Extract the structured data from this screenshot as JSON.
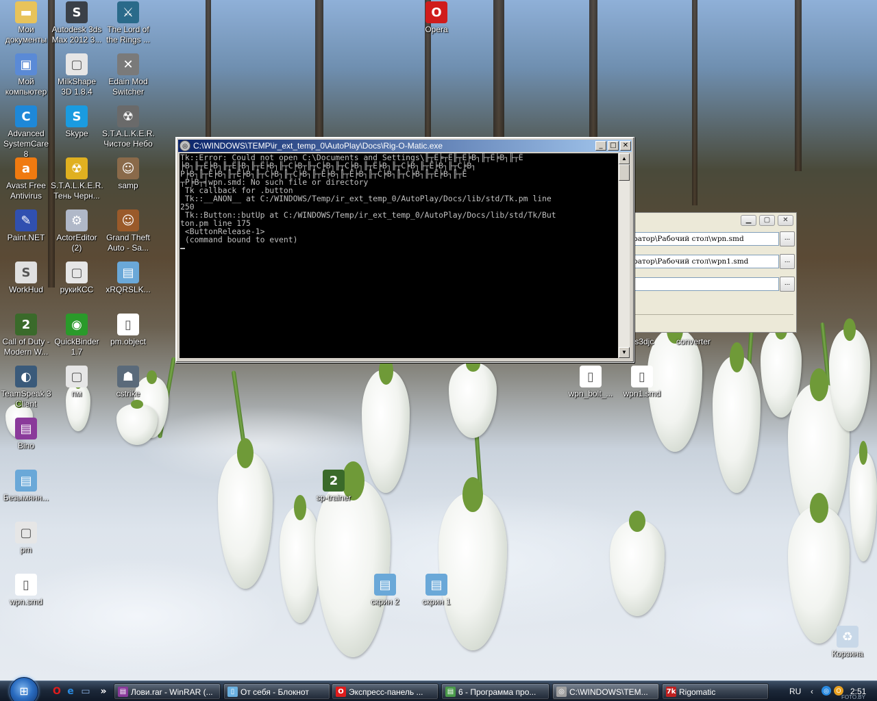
{
  "desktop_icons": [
    {
      "label": "Мои\nдокументы",
      "icon": "folder-icon",
      "color": "#e8c35a",
      "glyph": "▬"
    },
    {
      "label": "Autodesk 3ds\nMax 2012 3...",
      "icon": "3dsmax-icon",
      "color": "#3a4048",
      "glyph": "S"
    },
    {
      "label": "The Lord of\nthe Rings ...",
      "icon": "lotr-game-icon",
      "color": "#2a6a8a",
      "glyph": "⚔"
    },
    {
      "label": "Opera",
      "icon": "opera-icon",
      "color": "#d01c1c",
      "glyph": "O"
    },
    {
      "label": "Мой\nкомпьютер",
      "icon": "computer-icon",
      "color": "#5a8ad6",
      "glyph": "▣"
    },
    {
      "label": "MilkShape\n3D 1.8.4",
      "icon": "milkshape-icon",
      "color": "#e6e6e6",
      "glyph": "▢"
    },
    {
      "label": "Edain Mod\nSwitcher",
      "icon": "sword-icon",
      "color": "#7a7a7a",
      "glyph": "✕"
    },
    {
      "label": "Advanced\nSystemCare 8",
      "icon": "systemcare-icon",
      "color": "#1e88d8",
      "glyph": "C"
    },
    {
      "label": "Skype",
      "icon": "skype-icon",
      "color": "#1a9be0",
      "glyph": "S"
    },
    {
      "label": "S.T.A.L.K.E.R.\nЧистое Небо",
      "icon": "stalker-icon",
      "color": "#6a6a6a",
      "glyph": "☢"
    },
    {
      "label": "Avast Free\nAntivirus",
      "icon": "avast-icon",
      "color": "#f07a10",
      "glyph": "a"
    },
    {
      "label": "S.T.A.L.K.E.R.\nТень Черн...",
      "icon": "radiation-icon",
      "color": "#e0b020",
      "glyph": "☢"
    },
    {
      "label": "samp",
      "icon": "samp-icon",
      "color": "#8a6a4a",
      "glyph": "☺"
    },
    {
      "label": "Paint.NET",
      "icon": "paintnet-icon",
      "color": "#3050b0",
      "glyph": "✎"
    },
    {
      "label": "ActorEditor\n(2)",
      "icon": "gear-icon",
      "color": "#b0b8c8",
      "glyph": "⚙"
    },
    {
      "label": "Grand Theft\nAuto - Sa...",
      "icon": "gta-icon",
      "color": "#9a5a2a",
      "glyph": "☺"
    },
    {
      "label": "WorkHud",
      "icon": "3dsmax-file-icon",
      "color": "#e0e0e0",
      "glyph": "S"
    },
    {
      "label": "рукиКСС",
      "icon": "milkshape-file-icon",
      "color": "#e6e6e6",
      "glyph": "▢"
    },
    {
      "label": "xRQRSLK...",
      "icon": "image-file-icon",
      "color": "#6aa8d8",
      "glyph": "▤"
    },
    {
      "label": "Call of Duty -\nModern W...",
      "icon": "cod-icon",
      "color": "#3a6a2a",
      "glyph": "2"
    },
    {
      "label": "QuickBinder\n1.7",
      "icon": "quickbinder-icon",
      "color": "#2a9a2a",
      "glyph": "◉"
    },
    {
      "label": "pm.object",
      "icon": "document-icon",
      "color": "#ffffff",
      "glyph": "▯"
    },
    {
      "label": "TeamSpeak 3\nClient",
      "icon": "teamspeak-icon",
      "color": "#3a5a7a",
      "glyph": "◐"
    },
    {
      "label": "пм",
      "icon": "milkshape-file-icon",
      "color": "#e6e6e6",
      "glyph": "▢"
    },
    {
      "label": "cstrike",
      "icon": "counter-strike-icon",
      "color": "#5a6a7a",
      "glyph": "☗"
    },
    {
      "label": "Bino",
      "icon": "winrar-icon",
      "color": "#8a3a9a",
      "glyph": "▤"
    },
    {
      "label": "Безымянн...",
      "icon": "image-file-icon",
      "color": "#6aa8d8",
      "glyph": "▤"
    },
    {
      "label": "pm",
      "icon": "milkshape-file-icon",
      "color": "#e6e6e6",
      "glyph": "▢"
    },
    {
      "label": "wpn.smd",
      "icon": "document-icon",
      "color": "#ffffff",
      "glyph": "▯"
    },
    {
      "label": "sp-trainer",
      "icon": "cod-icon",
      "color": "#3a6a2a",
      "glyph": "2"
    },
    {
      "label": "скрин 2",
      "icon": "image-file-icon",
      "color": "#6aa8d8",
      "glyph": "▤"
    },
    {
      "label": "скрин 1",
      "icon": "image-file-icon",
      "color": "#6aa8d8",
      "glyph": "▤"
    },
    {
      "label": "ns3djc",
      "icon": "partial-icon",
      "color": "transparent",
      "glyph": ""
    },
    {
      "label": "converter",
      "icon": "partial-icon",
      "color": "transparent",
      "glyph": ""
    },
    {
      "label": "wpn_bolt_...",
      "icon": "document-icon",
      "color": "#ffffff",
      "glyph": "▯"
    },
    {
      "label": "wpn1.smd",
      "icon": "document-icon",
      "color": "#ffffff",
      "glyph": "▯"
    },
    {
      "label": "Корзина",
      "icon": "recycle-bin-icon",
      "color": "#c8d8e8",
      "glyph": "♻"
    }
  ],
  "console": {
    "title": "C:\\WINDOWS\\TEMP\\ir_ext_temp_0\\AutoPlay\\Docs\\Rig-O-Matic.exe",
    "icon": "console-app-icon",
    "lines": [
      "Tk::Error: Could not open C:\\Documents and Settings\\╟┬Ё╞┬Ё╟┬Ё╞В┐╟┬Ё╞В┐╟┬Ё",
      "╞В┐╟┬Ё╞В┐╟┬Ё╟В┐╟┬Ё╞В┐╟┬С╞В┬╟┬С╞В┐╟┬С╞В┐╟┬Ё╞В┐╟┬С╞В┐╟┬Ё╞В┐╟┬С╞В┐",
      "Р╞В┐╟┬Ё╞В┐╟┬Ё╞В┐╟┬С╞В┐╟┬С╞В┐╟┬Ё╞В┐╟┬Ё╞В┐╟┬С╞В┐╟┬С╞В┐╟┬Ё╞В┐╟┬Ё",
      "┬Р╞В┬╡wpn.smd: No such file or directory",
      " Tk callback for .button",
      " Tk::__ANON__ at C:/WINDOWS/Temp/ir_ext_temp_0/AutoPlay/Docs/lib/std/Tk.pm line",
      "250",
      " Tk::Button::butUp at C:/WINDOWS/Temp/ir_ext_temp_0/AutoPlay/Docs/lib/std/Tk/But",
      "ton.pm line 175",
      " <ButtonRelease-1>",
      " (command bound to event)"
    ],
    "text_color": "#c0c0c0",
    "background": "#000000"
  },
  "rigo_window": {
    "field1": "ратор\\Рабочий стол\\wpn.smd",
    "field2": "ратор\\Рабочий стол\\wpn1.smd",
    "field3": "",
    "browse_label": "..."
  },
  "taskbar": {
    "start_icon": "windows-logo-icon",
    "quick_launch": [
      {
        "icon": "opera-icon",
        "glyph": "O",
        "color": "#e01c1c"
      },
      {
        "icon": "internet-explorer-icon",
        "glyph": "e",
        "color": "#2a8ae0"
      },
      {
        "icon": "show-desktop-icon",
        "glyph": "▭",
        "color": "#8ab0e0"
      },
      {
        "icon": "chevron-right-icon",
        "glyph": "»",
        "color": "#ffffff"
      }
    ],
    "buttons": [
      {
        "label": "Лови.rar - WinRAR (...",
        "icon": "winrar-icon",
        "glyph": "▤",
        "color": "#8a3a9a"
      },
      {
        "label": "От себя - Блокнот",
        "icon": "notepad-icon",
        "glyph": "▯",
        "color": "#6ab0e0"
      },
      {
        "label": "Экспресс-панель ...",
        "icon": "opera-icon",
        "glyph": "O",
        "color": "#e01c1c"
      },
      {
        "label": "6 - Программа про...",
        "icon": "image-viewer-icon",
        "glyph": "▤",
        "color": "#4a9a4a"
      },
      {
        "label": "C:\\WINDOWS\\TEM...",
        "icon": "console-app-icon",
        "glyph": "◎",
        "color": "#a0a0a0"
      },
      {
        "label": "Rigomatic",
        "icon": "rigomatic-icon",
        "glyph": "7k",
        "color": "#c02020"
      }
    ],
    "language": "RU",
    "time": "2:51",
    "tray_icons": [
      "chevron-left-icon",
      "network-icon",
      "opera-tray-icon"
    ],
    "watermark": "FOTO.BY"
  }
}
